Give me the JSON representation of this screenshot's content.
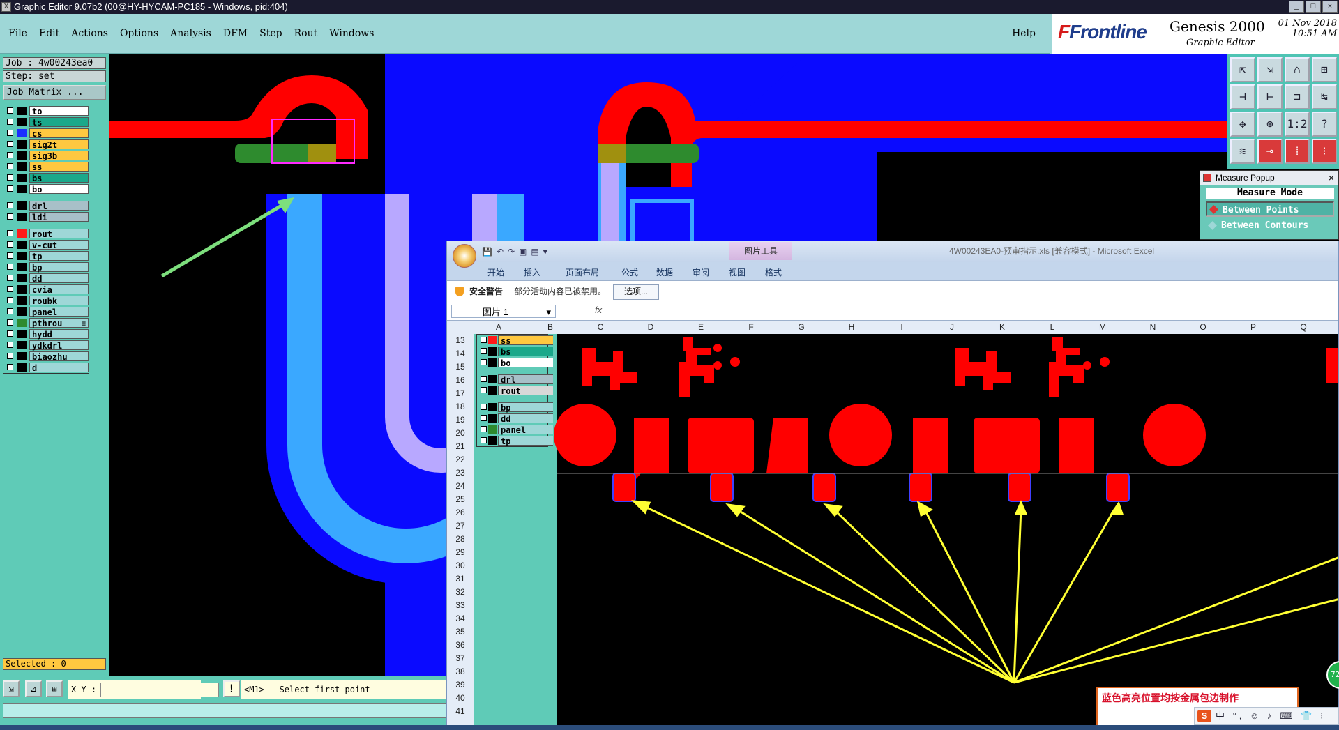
{
  "window": {
    "title": "Graphic Editor 9.07b2 (00@HY-HYCAM-PC185 - Windows, pid:404)",
    "controls": [
      "_",
      "□",
      "×"
    ]
  },
  "menu": {
    "items": [
      "File",
      "Edit",
      "Actions",
      "Options",
      "Analysis",
      "DFM",
      "Step",
      "Rout",
      "Windows"
    ],
    "help": "Help"
  },
  "brand": {
    "logo_mark": "F",
    "logo_text": "Frontline",
    "product": "Genesis 2000",
    "subtitle": "Graphic Editor",
    "date": "01 Nov 2018",
    "time": "10:51 AM"
  },
  "job": {
    "job_label": "Job : 4w00243ea0",
    "step_label": "Step: set",
    "matrix_button": "Job Matrix ...",
    "selected": "Selected : 0"
  },
  "layers": [
    {
      "name": "to",
      "bg": "#ffffff",
      "swatch": "#000000"
    },
    {
      "name": "ts",
      "bg": "#1aa88a",
      "swatch": "#000000"
    },
    {
      "name": "cs",
      "bg": "#ffc840",
      "swatch": "#1b2fff"
    },
    {
      "name": "sig2t",
      "bg": "#ffc840",
      "swatch": "#000000"
    },
    {
      "name": "sig3b",
      "bg": "#ffc840",
      "swatch": "#000000"
    },
    {
      "name": "ss",
      "bg": "#ffc840",
      "swatch": "#000000"
    },
    {
      "name": "bs",
      "bg": "#1aa88a",
      "swatch": "#000000"
    },
    {
      "name": "bo",
      "bg": "#ffffff",
      "swatch": "#000000"
    },
    {
      "name": "drl",
      "bg": "#a8c0c8",
      "swatch": "#000000",
      "gap": true
    },
    {
      "name": "ldi",
      "bg": "#a8c0c8",
      "swatch": "#000000"
    },
    {
      "name": "rout",
      "bg": "#9ed7d7",
      "swatch": "#ff1a1a",
      "gap": true
    },
    {
      "name": "v-cut",
      "bg": "#9ed7d7",
      "swatch": "#000000"
    },
    {
      "name": "tp",
      "bg": "#9ed7d7",
      "swatch": "#000000"
    },
    {
      "name": "bp",
      "bg": "#9ed7d7",
      "swatch": "#000000"
    },
    {
      "name": "dd",
      "bg": "#9ed7d7",
      "swatch": "#000000"
    },
    {
      "name": "cvia",
      "bg": "#9ed7d7",
      "swatch": "#000000"
    },
    {
      "name": "roubk",
      "bg": "#9ed7d7",
      "swatch": "#000000"
    },
    {
      "name": "panel",
      "bg": "#9ed7d7",
      "swatch": "#000000"
    },
    {
      "name": "pthrou",
      "bg": "#9ed7d7",
      "swatch": "#2e8b2e",
      "mark": "≡"
    },
    {
      "name": "hydd",
      "bg": "#9ed7d7",
      "swatch": "#000000"
    },
    {
      "name": "ydkdrl",
      "bg": "#9ed7d7",
      "swatch": "#000000"
    },
    {
      "name": "biaozhu",
      "bg": "#9ed7d7",
      "swatch": "#000000"
    },
    {
      "name": "d",
      "bg": "#9ed7d7",
      "swatch": "#000000"
    }
  ],
  "measure": {
    "title": "Measure Popup",
    "close": "×",
    "header": "Measure Mode",
    "options": [
      "Between Points",
      "Between Contours"
    ]
  },
  "toolbox": {
    "icons": [
      "⇱",
      "⇲",
      "⌂",
      "⊞",
      "⊣",
      "⊢",
      "⊐",
      "↹",
      "✥",
      "⊕",
      "1:2",
      "?",
      "≋",
      "⊸",
      "⁞",
      "⁝"
    ]
  },
  "command": {
    "xy_label": "X Y :",
    "prompt": "<M1> - Select first point",
    "warn": "!"
  },
  "excel": {
    "context_tab": "图片工具",
    "doc_title": "4W00243EA0-预审指示.xls  [兼容模式] - Microsoft Excel",
    "ribbon_tabs": [
      "开始",
      "插入",
      "页面布局",
      "公式",
      "数据",
      "审阅",
      "视图",
      "格式"
    ],
    "warning_title": "安全警告",
    "warning_msg": "部分活动内容已被禁用。",
    "warning_button": "选项...",
    "name_box": "图片 1",
    "fx": "fx",
    "columns": [
      "A",
      "B",
      "C",
      "D",
      "E",
      "F",
      "G",
      "H",
      "I",
      "J",
      "K",
      "L",
      "M",
      "N",
      "O",
      "P",
      "Q"
    ],
    "rows": [
      "13",
      "14",
      "15",
      "16",
      "17",
      "18",
      "19",
      "20",
      "21",
      "22",
      "23",
      "24",
      "25",
      "26",
      "27",
      "28",
      "29",
      "30",
      "31",
      "32",
      "33",
      "34",
      "35",
      "36",
      "37",
      "38",
      "39",
      "40",
      "41"
    ],
    "embedded_layers": [
      {
        "name": "ss",
        "bg": "#ffc840",
        "swatch": "#ff1a1a"
      },
      {
        "name": "bs",
        "bg": "#1aa88a",
        "swatch": "#000000"
      },
      {
        "name": "bo",
        "bg": "#ffffff",
        "swatch": "#000000"
      },
      {
        "name": "drl",
        "bg": "#a8c0c8",
        "swatch": "#000000",
        "gap": true
      },
      {
        "name": "rout",
        "bg": "#d8d8d8",
        "swatch": "#000000"
      },
      {
        "name": "bp",
        "bg": "#9ed7d7",
        "swatch": "#000000",
        "gap": true
      },
      {
        "name": "dd",
        "bg": "#9ed7d7",
        "swatch": "#000000"
      },
      {
        "name": "panel",
        "bg": "#9ed7d7",
        "swatch": "#2e8b2e"
      },
      {
        "name": "tp",
        "bg": "#9ed7d7",
        "swatch": "#000000"
      }
    ],
    "note": "蓝色高亮位置均按金属包边制作"
  },
  "ime": {
    "logo": "S",
    "items": "中 °, ☺ ♪ ⌨ 👕 ⁝"
  },
  "badge": "72"
}
